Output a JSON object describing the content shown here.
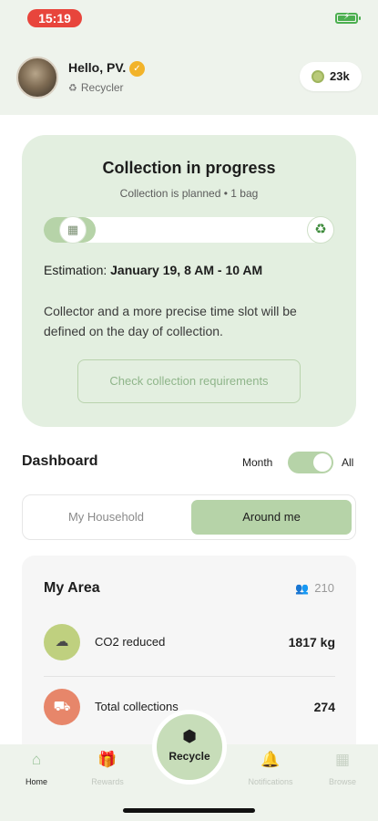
{
  "status_bar": {
    "time": "15:19"
  },
  "header": {
    "greeting": "Hello, PV.",
    "role": "Recycler",
    "points": "23k",
    "icons": {
      "badge": "verified-badge-icon",
      "role": "recycler-icon",
      "points": "coin-icon"
    }
  },
  "collection_card": {
    "title": "Collection in progress",
    "subtitle": "Collection is planned • 1 bag",
    "estimation_label": "Estimation:",
    "estimation_value": "January 19, 8 AM - 10 AM",
    "info": "Collector and a more precise time slot will be defined on the day of collection.",
    "check_button": "Check collection requirements",
    "progress_fraction": 0.18,
    "icons": {
      "start": "calendar-icon",
      "end": "recycle-icon"
    }
  },
  "dashboard": {
    "title": "Dashboard",
    "toggle_left": "Month",
    "toggle_right": "All",
    "toggle_selected": "All",
    "tabs": [
      "My Household",
      "Around me"
    ],
    "selected_tab": "Around me"
  },
  "area": {
    "title": "My Area",
    "count": "210",
    "stats": [
      {
        "label": "CO2 reduced",
        "value": "1817 kg",
        "icon": "cloud-icon",
        "color": "#bfd07f"
      },
      {
        "label": "Total collections",
        "value": "274",
        "icon": "truck-icon",
        "color": "#e7866a"
      }
    ]
  },
  "bottom_nav": {
    "items": [
      {
        "label": "Home",
        "icon": "home-icon",
        "active": true
      },
      {
        "label": "Rewards",
        "icon": "gift-icon",
        "active": false
      },
      {
        "label": "Notifications",
        "icon": "bell-icon",
        "active": false
      },
      {
        "label": "Browse",
        "icon": "grid-icon",
        "active": false
      }
    ],
    "center_label": "Recycle",
    "center_icon": "recycle-pin-icon"
  },
  "colors": {
    "accent": "#b6d3a8",
    "card_background": "#e3efe0",
    "time_pill": "#e8453c"
  }
}
